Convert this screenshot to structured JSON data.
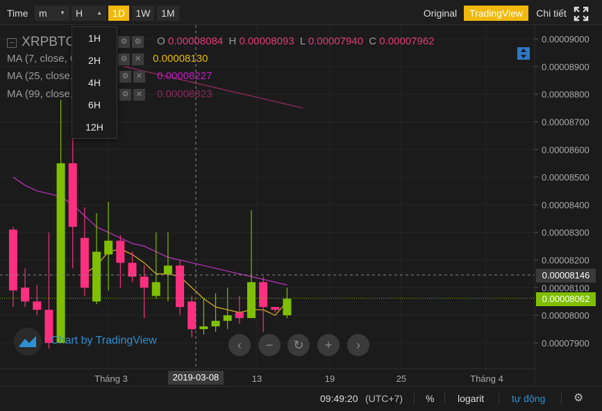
{
  "toolbar": {
    "time_label": "Time",
    "minute_dropdown": "m",
    "hour_dropdown": "H",
    "interval_1d": "1D",
    "interval_1w": "1W",
    "interval_1m": "1M",
    "view_original": "Original",
    "view_tradingview": "TradingView",
    "view_depth": "Chi tiết",
    "active_view": "TradingView",
    "active_interval": "1D"
  },
  "legend": {
    "symbol": "XRPBTC",
    "open_label": "O",
    "open_value": "0.00008084",
    "high_label": "H",
    "high_value": "0.00008093",
    "low_label": "L",
    "low_value": "0.00007940",
    "close_label": "C",
    "close_value": "0.00007962",
    "ma7_name": "MA (7, close, 0)",
    "ma7_value": "0.00008130",
    "ma25_name": "MA (25, close, 0)",
    "ma25_value": "0.00008227",
    "ma99_name": "MA (99, close, 0)",
    "ma99_value": "0.00008823"
  },
  "resolution_menu": {
    "items": [
      "1H",
      "2H",
      "4H",
      "6H",
      "12H"
    ]
  },
  "watermark": {
    "text": "Chart by TradingView"
  },
  "price_axis": {
    "labels": [
      "0.00009000",
      "0.00008900",
      "0.00008800",
      "0.00008700",
      "0.00008600",
      "0.00008500",
      "0.00008400",
      "0.00008300",
      "0.00008200",
      "0.00008100",
      "0.00008000",
      "0.00007900"
    ],
    "crosshair_price": "0.00008146",
    "last_price": "0.00008062"
  },
  "time_axis": {
    "labels": [
      "Tháng 3",
      "13",
      "19",
      "25",
      "Tháng 4"
    ],
    "crosshair_date": "2019-03-08"
  },
  "bottom_bar": {
    "clock": "09:49:20",
    "timezone": "(UTC+7)",
    "percent": "%",
    "log": "logarit",
    "auto": "tự động"
  },
  "colors": {
    "up": "#7fbf00",
    "down": "#ff2f7f",
    "ma7": "#c9a227",
    "ma25": "#b030b0",
    "ma99": "#8b2a5a",
    "accent": "#f0b90b",
    "link": "#2f8fd3"
  },
  "chart_data": {
    "type": "candlestick",
    "candles": [
      {
        "o": 8.31e-05,
        "h": 8.32e-05,
        "l": 8.03e-05,
        "c": 8.09e-05
      },
      {
        "o": 8.1e-05,
        "h": 8.17e-05,
        "l": 8.03e-05,
        "c": 8.05e-05
      },
      {
        "o": 8.05e-05,
        "h": 8.11e-05,
        "l": 8e-05,
        "c": 8.02e-05
      },
      {
        "o": 8.02e-05,
        "h": 8.3e-05,
        "l": 7.88e-05,
        "c": 7.9e-05
      },
      {
        "o": 7.9e-05,
        "h": 8.78e-05,
        "l": 7.9e-05,
        "c": 8.55e-05
      },
      {
        "o": 8.55e-05,
        "h": 8.64e-05,
        "l": 8.17e-05,
        "c": 8.32e-05
      },
      {
        "o": 8.28e-05,
        "h": 8.39e-05,
        "l": 8.07e-05,
        "c": 8.1e-05
      },
      {
        "o": 8.05e-05,
        "h": 8.37e-05,
        "l": 8.04e-05,
        "c": 8.23e-05
      },
      {
        "o": 8.22e-05,
        "h": 8.41e-05,
        "l": 8.09e-05,
        "c": 8.27e-05
      },
      {
        "o": 8.27e-05,
        "h": 8.29e-05,
        "l": 8.1e-05,
        "c": 8.19e-05
      },
      {
        "o": 8.19e-05,
        "h": 8.23e-05,
        "l": 8.12e-05,
        "c": 8.14e-05
      },
      {
        "o": 8.14e-05,
        "h": 8.18e-05,
        "l": 7.99e-05,
        "c": 8.1e-05
      },
      {
        "o": 8.07e-05,
        "h": 8.3e-05,
        "l": 8.06e-05,
        "c": 8.12e-05
      },
      {
        "o": 8.15e-05,
        "h": 8.3e-05,
        "l": 8.05e-05,
        "c": 8.18e-05
      },
      {
        "o": 8.18e-05,
        "h": 8.2e-05,
        "l": 8e-05,
        "c": 8.03e-05
      },
      {
        "o": 8.05e-05,
        "h": 8.07e-05,
        "l": 7.92e-05,
        "c": 7.95e-05
      },
      {
        "o": 7.95e-05,
        "h": 8.06e-05,
        "l": 7.93e-05,
        "c": 7.96e-05
      },
      {
        "o": 7.96e-05,
        "h": 8.08e-05,
        "l": 7.94e-05,
        "c": 7.98e-05
      },
      {
        "o": 7.98e-05,
        "h": 8.1e-05,
        "l": 7.95e-05,
        "c": 8e-05
      },
      {
        "o": 8.01e-05,
        "h": 8.07e-05,
        "l": 7.97e-05,
        "c": 7.99e-05
      },
      {
        "o": 7.99e-05,
        "h": 8.38e-05,
        "l": 7.99e-05,
        "c": 8.12e-05
      },
      {
        "o": 8.12e-05,
        "h": 8.14e-05,
        "l": 7.94e-05,
        "c": 8.03e-05
      },
      {
        "o": 8.03e-05,
        "h": 8.03e-05,
        "l": 8.01e-05,
        "c": 8.02e-05
      },
      {
        "o": 8e-05,
        "h": 8.1e-05,
        "l": 7.99e-05,
        "c": 8.06e-05
      }
    ],
    "ma7": [
      null,
      null,
      null,
      null,
      null,
      null,
      8.15e-05,
      8.18e-05,
      8.23e-05,
      8.24e-05,
      8.22e-05,
      8.19e-05,
      8.15e-05,
      8.15e-05,
      8.14e-05,
      8.1e-05,
      8.06e-05,
      8.03e-05,
      8.02e-05,
      8.01e-05,
      8.02e-05,
      8.02e-05,
      8e-05,
      8.05e-05
    ],
    "ma25": [
      8.5e-05,
      8.47e-05,
      8.45e-05,
      8.44e-05,
      8.43e-05,
      8.4e-05,
      8.36e-05,
      8.32e-05,
      8.3e-05,
      8.28e-05,
      8.26e-05,
      8.25e-05,
      8.23e-05,
      8.21e-05,
      8.2e-05,
      8.19e-05,
      8.18e-05,
      8.17e-05,
      8.16e-05,
      8.15e-05,
      8.14e-05,
      8.13e-05,
      8.12e-05,
      8.11e-05
    ],
    "ma99": [
      8.9e-05,
      8.89e-05,
      8.88e-05,
      8.87e-05,
      8.86e-05,
      8.85e-05,
      8.84e-05,
      8.83e-05,
      8.82e-05,
      8.81e-05,
      8.8e-05,
      8.79e-05,
      8.78e-05,
      8.77e-05,
      8.76e-05,
      8.75e-05
    ],
    "ylim": [
      7.85e-05,
      9.1e-05
    ],
    "grid": true
  }
}
